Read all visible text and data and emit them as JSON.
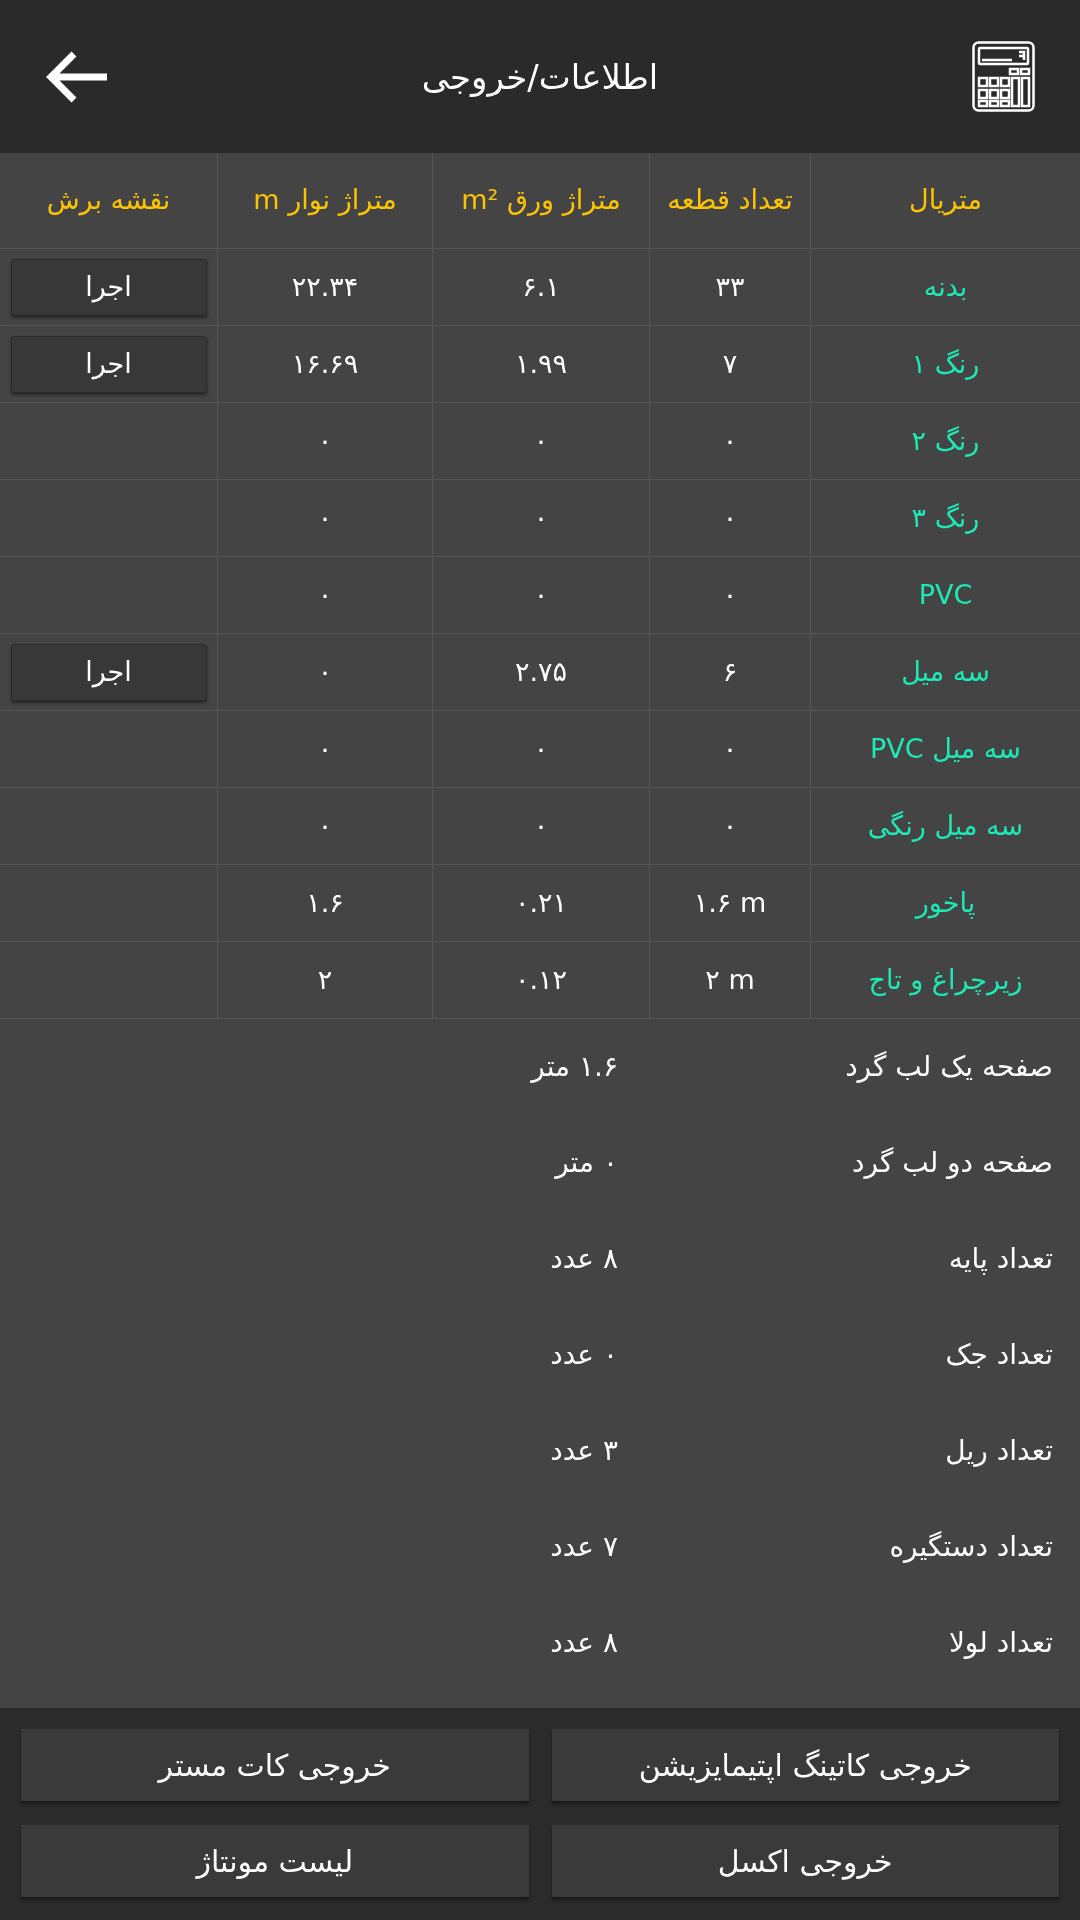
{
  "header": {
    "title": "اطلاعات/خروجی"
  },
  "table": {
    "columns": [
      "متریال",
      "تعداد قطعه",
      "متراژ ورق m²",
      "متراژ نوار m",
      "نقشه برش"
    ],
    "rows": [
      {
        "material": "بدنه",
        "pieces": "۳۳",
        "sheet_area": "۶.۱",
        "strip_length": "۲۲.۳۴",
        "cut_map_button": "اجرا"
      },
      {
        "material": "رنگ ۱",
        "pieces": "۷",
        "sheet_area": "۱.۹۹",
        "strip_length": "۱۶.۶۹",
        "cut_map_button": "اجرا"
      },
      {
        "material": "رنگ ۲",
        "pieces": "۰",
        "sheet_area": "۰",
        "strip_length": "۰"
      },
      {
        "material": "رنگ ۳",
        "pieces": "۰",
        "sheet_area": "۰",
        "strip_length": "۰"
      },
      {
        "material": "PVC",
        "pieces": "۰",
        "sheet_area": "۰",
        "strip_length": "۰"
      },
      {
        "material": "سه میل",
        "pieces": "۶",
        "sheet_area": "۲.۷۵",
        "strip_length": "۰",
        "cut_map_button": "اجرا"
      },
      {
        "material": "سه میل PVC",
        "pieces": "۰",
        "sheet_area": "۰",
        "strip_length": "۰"
      },
      {
        "material": "سه میل رنگی",
        "pieces": "۰",
        "sheet_area": "۰",
        "strip_length": "۰"
      },
      {
        "material": "پاخور",
        "pieces": "۱.۶ m",
        "sheet_area": "۰.۲۱",
        "strip_length": "۱.۶"
      },
      {
        "material": "زیرچراغ و تاج",
        "pieces": "۲ m",
        "sheet_area": "۰.۱۲",
        "strip_length": "۲"
      }
    ]
  },
  "summary": [
    {
      "label": "صفحه یک لب گرد",
      "value": "۱.۶ متر"
    },
    {
      "label": "صفحه دو لب گرد",
      "value": "۰ متر"
    },
    {
      "label": "تعداد پایه",
      "value": "۸ عدد"
    },
    {
      "label": "تعداد جک",
      "value": "۰ عدد"
    },
    {
      "label": "تعداد ریل",
      "value": "۳ عدد"
    },
    {
      "label": "تعداد دستگیره",
      "value": "۷ عدد"
    },
    {
      "label": "تعداد لولا",
      "value": "۸ عدد"
    }
  ],
  "buttons": [
    "خروجی کاتینگ اپتیمایزیشن",
    "خروجی کات مستر",
    "خروجی اکسل",
    "لیست مونتاژ"
  ]
}
